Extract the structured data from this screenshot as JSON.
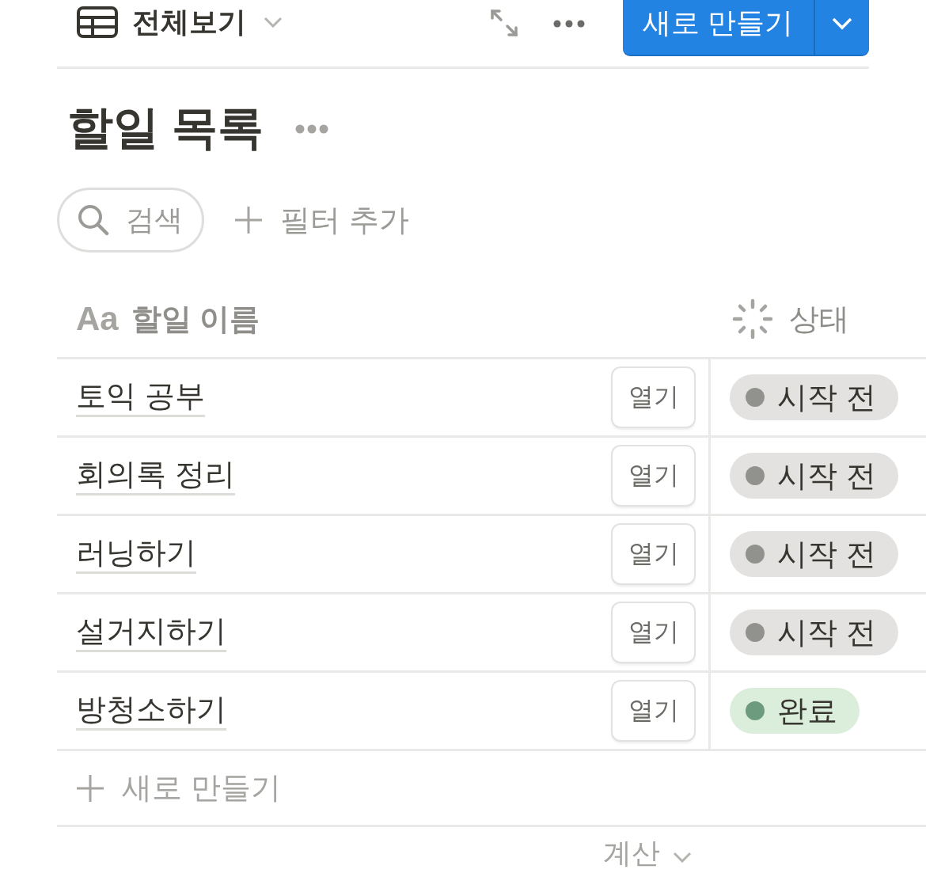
{
  "toolbar": {
    "view_label": "전체보기",
    "new_button": "새로 만들기"
  },
  "title": "할일 목록",
  "search": {
    "placeholder": "검색"
  },
  "filter_button": "필터 추가",
  "table": {
    "columns": [
      {
        "kind": "title",
        "type_label": "Aa",
        "label": "할일 이름"
      },
      {
        "kind": "status",
        "label": "상태"
      }
    ],
    "rows": [
      {
        "name": "토익 공부",
        "open_label": "열기",
        "status": {
          "kind": "not_started",
          "label": "시작 전",
          "color": "#91918e"
        }
      },
      {
        "name": "회의록 정리",
        "open_label": "열기",
        "status": {
          "kind": "not_started",
          "label": "시작 전",
          "color": "#91918e"
        }
      },
      {
        "name": "러닝하기",
        "open_label": "열기",
        "status": {
          "kind": "not_started",
          "label": "시작 전",
          "color": "#91918e"
        }
      },
      {
        "name": "설거지하기",
        "open_label": "열기",
        "status": {
          "kind": "not_started",
          "label": "시작 전",
          "color": "#91918e"
        }
      },
      {
        "name": "방청소하기",
        "open_label": "열기",
        "status": {
          "kind": "done",
          "label": "완료",
          "color": "#6c9b7d"
        }
      }
    ],
    "add_row": "새로 만들기",
    "footer": "계산"
  }
}
